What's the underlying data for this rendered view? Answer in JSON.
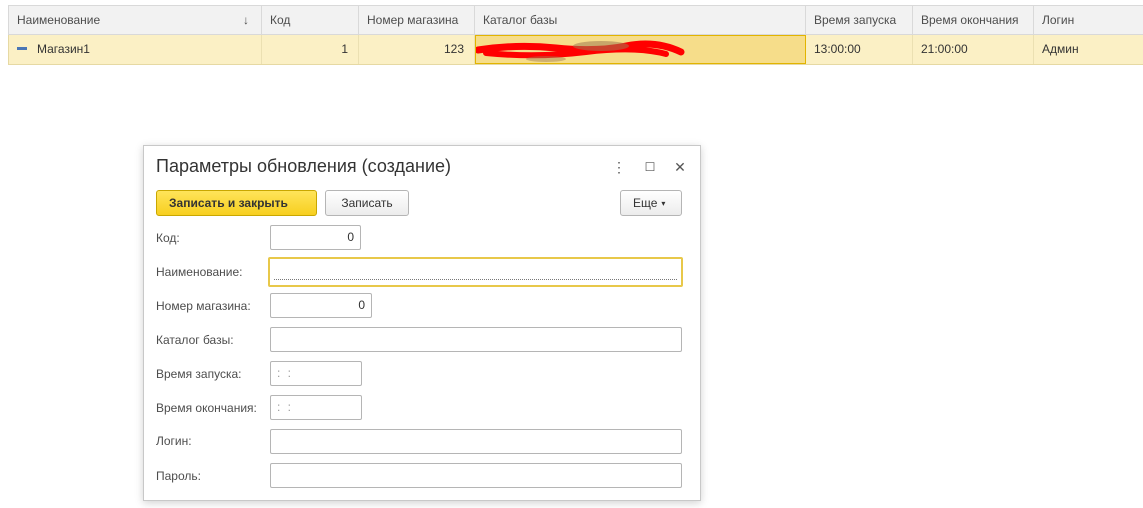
{
  "grid": {
    "columns": [
      {
        "label": "Наименование"
      },
      {
        "label": "Код"
      },
      {
        "label": "Номер магазина"
      },
      {
        "label": "Каталог базы"
      },
      {
        "label": "Время запуска"
      },
      {
        "label": "Время окончания"
      },
      {
        "label": "Логин"
      }
    ],
    "sort_indicator": "↓",
    "rows": [
      {
        "name": "Магазин1",
        "code": "1",
        "store_number": "123",
        "catalog": "",
        "start_time": "13:00:00",
        "end_time": "21:00:00",
        "login": "Админ"
      }
    ]
  },
  "dialog": {
    "title": "Параметры обновления (создание)",
    "controls": {
      "more": "⋮",
      "maximize": "☐",
      "close": "✕"
    },
    "toolbar": {
      "save_close": "Записать и закрыть",
      "save": "Записать",
      "more": "Еще",
      "more_caret": "▾"
    },
    "fields": {
      "code": {
        "label": "Код:",
        "value": "0"
      },
      "name": {
        "label": "Наименование:",
        "value": ""
      },
      "store_number": {
        "label": "Номер магазина:",
        "value": "0"
      },
      "catalog": {
        "label": "Каталог базы:",
        "value": ""
      },
      "start_time": {
        "label": "Время запуска:",
        "value": " :  :"
      },
      "end_time": {
        "label": "Время окончания:",
        "value": " :  :"
      },
      "login": {
        "label": "Логин:",
        "value": ""
      },
      "password": {
        "label": "Пароль:",
        "value": ""
      }
    }
  },
  "colors": {
    "selected_row": "#fbf0c5",
    "primary_button": "#f7cf1f",
    "focus_border": "#e8c84a",
    "redaction": "#ff0000"
  }
}
